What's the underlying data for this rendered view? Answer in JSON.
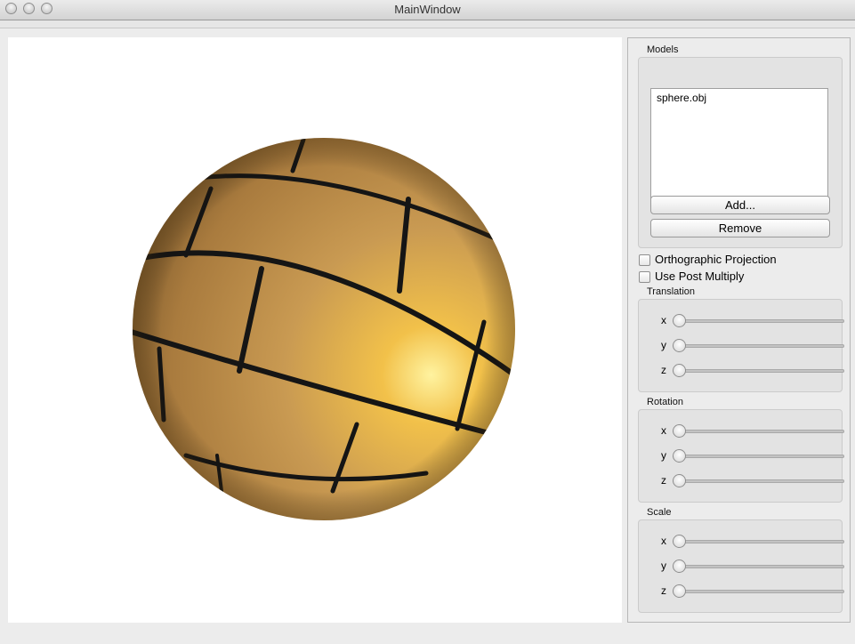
{
  "window": {
    "title": "MainWindow"
  },
  "models": {
    "group_title": "Models",
    "items": [
      "sphere.obj"
    ],
    "add_label": "Add...",
    "remove_label": "Remove"
  },
  "options": {
    "orthographic_label": "Orthographic Projection",
    "orthographic_checked": false,
    "post_multiply_label": "Use Post Multiply",
    "post_multiply_checked": false
  },
  "translation": {
    "title": "Translation",
    "x_label": "x",
    "y_label": "y",
    "z_label": "z",
    "x": 0,
    "y": 0,
    "z": 0
  },
  "rotation": {
    "title": "Rotation",
    "x_label": "x",
    "y_label": "y",
    "z_label": "z",
    "x": 0,
    "y": 0,
    "z": 0
  },
  "scale": {
    "title": "Scale",
    "x_label": "x",
    "y_label": "y",
    "z_label": "z",
    "x": 0,
    "y": 0,
    "z": 0
  },
  "colors": {
    "brick": "#c9974b",
    "mortar": "#151515",
    "viewport_bg": "#ffffff"
  }
}
